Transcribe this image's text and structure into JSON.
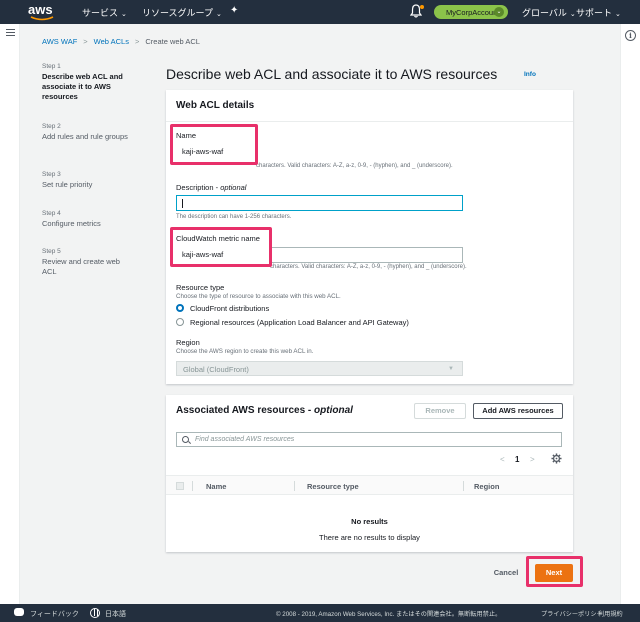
{
  "topbar": {
    "logo": "aws",
    "services": "サービス",
    "resource_groups": "リソースグループ",
    "account": "MyCorpAccount",
    "region": "グローバル",
    "support": "サポート",
    "caret": "⌄"
  },
  "breadcrumb": {
    "items": [
      "AWS WAF",
      "Web ACLs",
      "Create web ACL"
    ],
    "separator": ">"
  },
  "steps": [
    {
      "num": "Step 1",
      "name": "Describe web ACL and associate it to AWS resources"
    },
    {
      "num": "Step 2",
      "name": "Add rules and rule groups"
    },
    {
      "num": "Step 3",
      "name": "Set rule priority"
    },
    {
      "num": "Step 4",
      "name": "Configure metrics"
    },
    {
      "num": "Step 5",
      "name": "Review and create web ACL"
    }
  ],
  "page": {
    "title": "Describe web ACL and associate it to AWS resources",
    "info": "Info"
  },
  "details": {
    "heading": "Web ACL details",
    "name_label": "Name",
    "name_value": "kaji-aws-waf",
    "name_hint": "The name must have 1-128 characters. Valid characters: A-Z, a-z, 0-9, - (hyphen), and _ (underscore).",
    "description_label": "Description",
    "description_optional": "optional",
    "description_value": "",
    "description_hint": "The description can have 1-256 characters.",
    "metric_label": "CloudWatch metric name",
    "metric_value": "kaji-aws-waf",
    "metric_hint": "The name must have 1-128 characters. Valid characters: A-Z, a-z, 0-9, - (hyphen), and _ (underscore).",
    "resource_type_label": "Resource type",
    "resource_type_hint": "Choose the type of resource to associate with this web ACL.",
    "resource_options": [
      "CloudFront distributions",
      "Regional resources (Application Load Balancer and API Gateway)"
    ],
    "resource_selected": 0,
    "region_label": "Region",
    "region_hint": "Choose the AWS region to create this web ACL in.",
    "region_value": "Global (CloudFront)"
  },
  "resources": {
    "heading": "Associated AWS resources",
    "heading_optional": "optional",
    "remove_button": "Remove",
    "add_button": "Add AWS resources",
    "search_placeholder": "Find associated AWS resources",
    "page": "1",
    "prev": "<",
    "next": ">",
    "columns": [
      "Name",
      "Resource type",
      "Region"
    ],
    "empty_title": "No results",
    "empty_subtitle": "There are no results to display"
  },
  "actions": {
    "cancel": "Cancel",
    "next": "Next"
  },
  "footer": {
    "feedback": "フィードバック",
    "language": "日本語",
    "copyright": "© 2008 - 2019, Amazon Web Services, Inc. またはその関連会社。無断転用禁止。",
    "privacy": "プライバシーポリシー",
    "terms": "利用規約"
  },
  "colors": {
    "nav_bg": "#232f3e",
    "accent_orange": "#ec7211",
    "link_blue": "#0073bb",
    "highlight_pink": "#e8306a",
    "account_green": "#8bc34a"
  }
}
